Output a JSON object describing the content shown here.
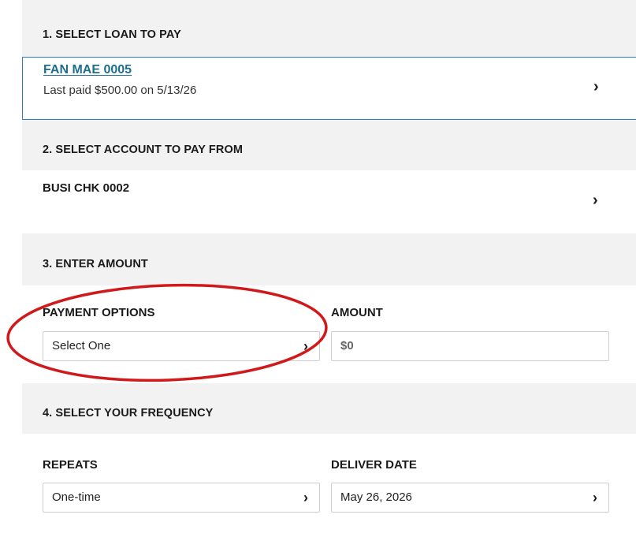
{
  "sections": {
    "loan": {
      "title": "1. SELECT LOAN TO PAY",
      "loan_name": "FAN MAE 0005",
      "last_paid": "Last paid $500.00 on 5/13/26"
    },
    "account": {
      "title": "2. SELECT ACCOUNT TO PAY FROM",
      "account_name": "BUSI CHK 0002"
    },
    "amount": {
      "title": "3. ENTER AMOUNT",
      "payment_options_label": "PAYMENT OPTIONS",
      "payment_options_value": "Select One",
      "amount_label": "AMOUNT",
      "amount_placeholder": "$0"
    },
    "frequency": {
      "title": "4. SELECT YOUR FREQUENCY",
      "repeats_label": "REPEATS",
      "repeats_value": "One-time",
      "deliver_label": "DELIVER DATE",
      "deliver_value": "May 26, 2026"
    }
  },
  "icons": {
    "chevron": "chevron-right-icon",
    "chevron_glyph": "›"
  },
  "colors": {
    "link": "#1f6e8c",
    "selected_border": "#2f7fc4",
    "annotation": "#d0191b"
  }
}
